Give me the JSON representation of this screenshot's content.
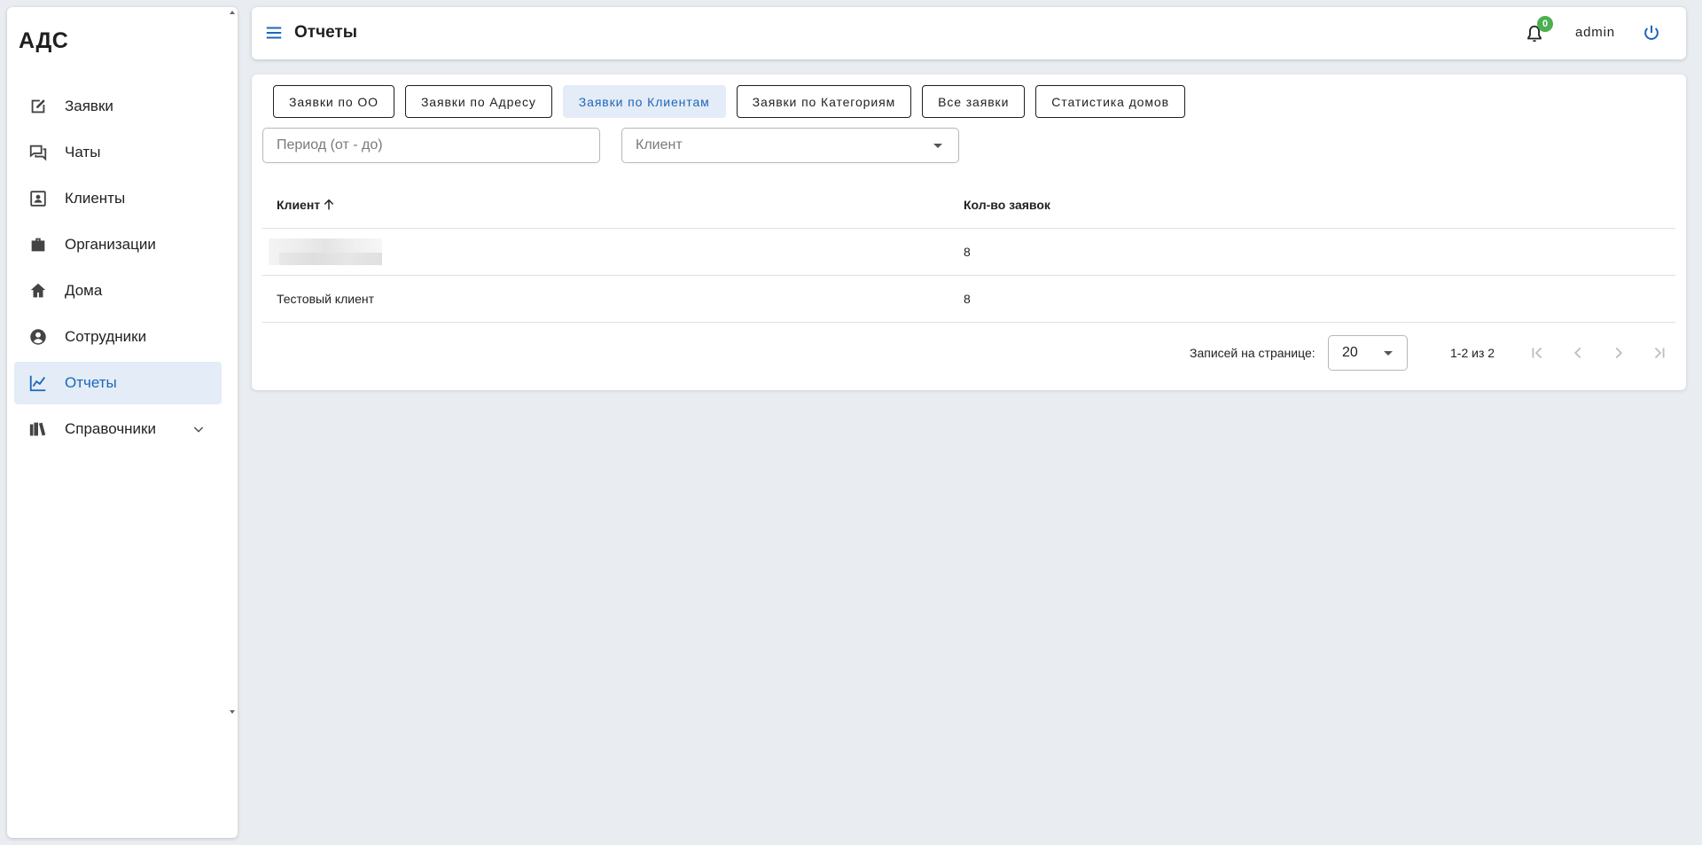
{
  "app": {
    "logo": "АДС"
  },
  "sidebar": {
    "items": [
      {
        "label": "Заявки",
        "icon": "edit-icon"
      },
      {
        "label": "Чаты",
        "icon": "chat-icon"
      },
      {
        "label": "Клиенты",
        "icon": "contact-icon"
      },
      {
        "label": "Организации",
        "icon": "briefcase-icon"
      },
      {
        "label": "Дома",
        "icon": "home-icon"
      },
      {
        "label": "Сотрудники",
        "icon": "account-icon"
      },
      {
        "label": "Отчеты",
        "icon": "chart-line-icon",
        "active": true
      },
      {
        "label": "Справочники",
        "icon": "book-icon",
        "expandable": true
      }
    ]
  },
  "header": {
    "title": "Отчеты",
    "notifications_count": "0",
    "user": "admin"
  },
  "tabs": [
    {
      "label": "Заявки по ОО"
    },
    {
      "label": "Заявки по Адресу"
    },
    {
      "label": "Заявки по Клиентам",
      "active": true
    },
    {
      "label": "Заявки по Категориям"
    },
    {
      "label": "Все заявки"
    },
    {
      "label": "Статистика домов"
    }
  ],
  "filters": {
    "period_placeholder": "Период (от - до)",
    "client_placeholder": "Клиент"
  },
  "table": {
    "columns": [
      "Клиент",
      "Кол-во заявок"
    ],
    "rows": [
      {
        "client": "",
        "count": "8",
        "redacted": true
      },
      {
        "client": "Тестовый клиент",
        "count": "8"
      }
    ]
  },
  "pagination": {
    "rows_label": "Записей на странице:",
    "rows_per_page": "20",
    "range": "1-2 из 2"
  },
  "colors": {
    "accent": "#1e67b8",
    "active_bg": "#e3ecf7",
    "badge": "#4caf50",
    "background": "#e9edf1"
  }
}
